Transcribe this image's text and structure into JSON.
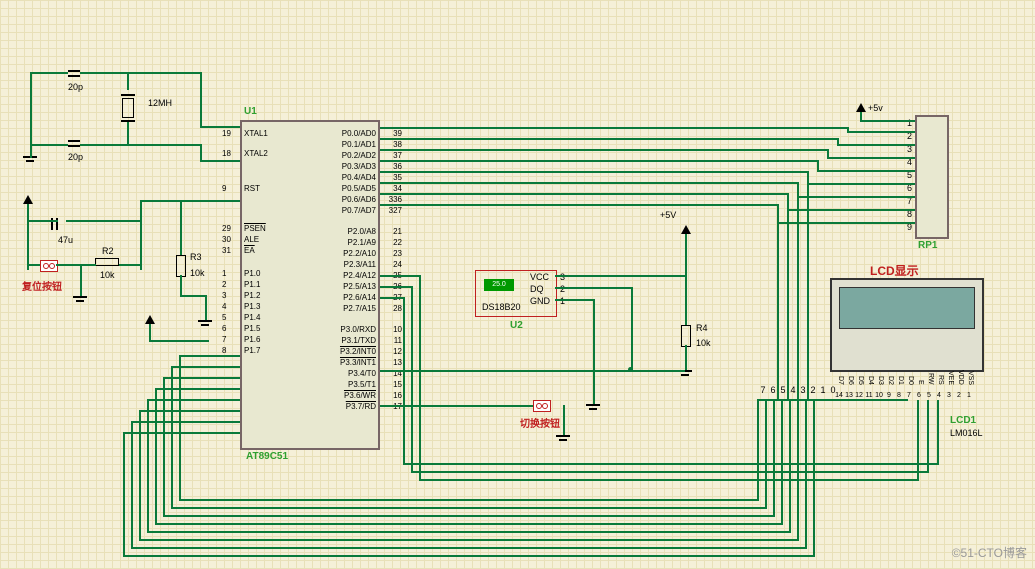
{
  "u1": {
    "ref": "U1",
    "part": "AT89C51",
    "left": [
      {
        "n": "19",
        "name": "XTAL1"
      },
      {
        "n": "18",
        "name": "XTAL2"
      },
      {
        "n": "9",
        "name": "RST"
      },
      {
        "n": "29",
        "name": "PSEN",
        "ov": true
      },
      {
        "n": "30",
        "name": "ALE"
      },
      {
        "n": "31",
        "name": "EA",
        "ov": true
      },
      {
        "n": "1",
        "name": "P1.0"
      },
      {
        "n": "2",
        "name": "P1.1"
      },
      {
        "n": "3",
        "name": "P1.2"
      },
      {
        "n": "4",
        "name": "P1.3"
      },
      {
        "n": "5",
        "name": "P1.4"
      },
      {
        "n": "6",
        "name": "P1.5"
      },
      {
        "n": "7",
        "name": "P1.6"
      },
      {
        "n": "8",
        "name": "P1.7"
      }
    ],
    "right": [
      {
        "n": "39",
        "name": "P0.0/AD0"
      },
      {
        "n": "38",
        "name": "P0.1/AD1"
      },
      {
        "n": "37",
        "name": "P0.2/AD2"
      },
      {
        "n": "36",
        "name": "P0.3/AD3"
      },
      {
        "n": "35",
        "name": "P0.4/AD4"
      },
      {
        "n": "34",
        "name": "P0.5/AD5"
      },
      {
        "n": "336",
        "name": "P0.6/AD6"
      },
      {
        "n": "327",
        "name": "P0.7/AD7"
      },
      {
        "n": "21",
        "name": "P2.0/A8"
      },
      {
        "n": "22",
        "name": "P2.1/A9"
      },
      {
        "n": "23",
        "name": "P2.2/A10"
      },
      {
        "n": "24",
        "name": "P2.3/A11"
      },
      {
        "n": "25",
        "name": "P2.4/A12"
      },
      {
        "n": "26",
        "name": "P2.5/A13"
      },
      {
        "n": "27",
        "name": "P2.6/A14"
      },
      {
        "n": "28",
        "name": "P2.7/A15"
      },
      {
        "n": "10",
        "name": "P3.0/RXD"
      },
      {
        "n": "11",
        "name": "P3.1/TXD"
      },
      {
        "n": "12",
        "name": "P3.2/INT0",
        "ov": true
      },
      {
        "n": "13",
        "name": "P3.3/INT1",
        "ov": true
      },
      {
        "n": "14",
        "name": "P3.4/T0"
      },
      {
        "n": "15",
        "name": "P3.5/T1"
      },
      {
        "n": "16",
        "name": "P3.6/WR",
        "ov": true
      },
      {
        "n": "17",
        "name": "P3.7/RD",
        "ov": true
      }
    ]
  },
  "c1": {
    "val": "20p"
  },
  "c2": {
    "val": "20p"
  },
  "c3": {
    "val": "47u"
  },
  "x1": {
    "val": "12MH"
  },
  "r2": {
    "ref": "R2",
    "val": "10k"
  },
  "r3": {
    "ref": "R3",
    "val": "10k"
  },
  "r4": {
    "ref": "R4",
    "val": "10k"
  },
  "rp1": {
    "ref": "RP1",
    "pins": [
      "1",
      "2",
      "3",
      "4",
      "5",
      "6",
      "7",
      "8",
      "9"
    ]
  },
  "u2": {
    "ref": "U2",
    "part": "DS18B20",
    "temp": "25.0",
    "pins": [
      "VCC",
      "DQ",
      "GND"
    ],
    "pn": [
      "3",
      "2",
      "1"
    ]
  },
  "lcd": {
    "ref": "LCD1",
    "part": "LM016L",
    "title": "LCD显示",
    "pins": [
      "D7",
      "D6",
      "D5",
      "D4",
      "D3",
      "D2",
      "D1",
      "D0",
      "E",
      "RW",
      "RS",
      "VEE",
      "VDD",
      "VSS"
    ],
    "pn": [
      "14",
      "13",
      "12",
      "11",
      "10",
      "9",
      "8",
      "7",
      "6",
      "5",
      "4",
      "3",
      "2",
      "1"
    ]
  },
  "buslabels": [
    "7",
    "6",
    "5",
    "4",
    "3",
    "2",
    "1",
    "0"
  ],
  "v5": "+5V",
  "v5s": "+5v",
  "t_reset": "复位按钮",
  "t_switch": "切换按钮",
  "wm": "©51-CTO博客"
}
